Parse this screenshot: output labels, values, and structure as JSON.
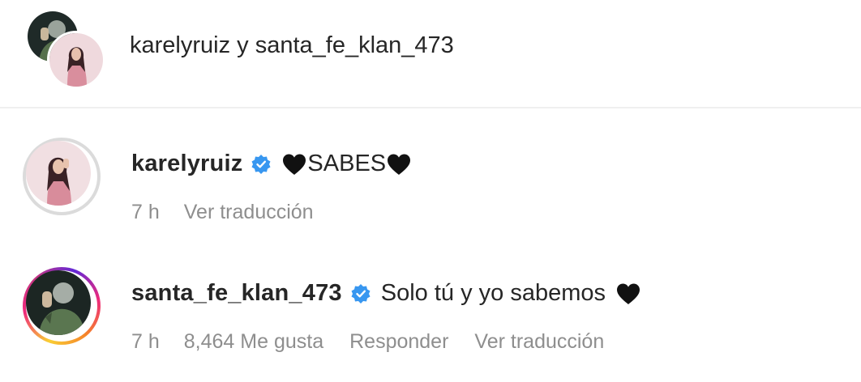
{
  "header": {
    "title": "karelyruiz y santa_fe_klan_473",
    "avatars": [
      {
        "name": "santa-fe-klan-avatar",
        "icon": "profile-photo"
      },
      {
        "name": "karelyruiz-avatar",
        "icon": "profile-photo"
      }
    ]
  },
  "comments": [
    {
      "username": "karelyruiz",
      "verified": true,
      "text": "SABES",
      "prefix_icon": "black-heart-icon",
      "suffix_icon": "black-heart-icon",
      "time": "7 h",
      "translate_label": "Ver traducción"
    },
    {
      "username": "santa_fe_klan_473",
      "verified": true,
      "text": "Solo tú y yo sabemos",
      "suffix_icon": "black-heart-icon",
      "has_story_ring": true,
      "time": "7 h",
      "likes": "8,464 Me gusta",
      "reply_label": "Responder",
      "translate_label": "Ver traducción"
    }
  ],
  "colors": {
    "text": "#262626",
    "meta": "#8e8e8e",
    "verified": "#3897f0",
    "divider": "#efefef"
  }
}
